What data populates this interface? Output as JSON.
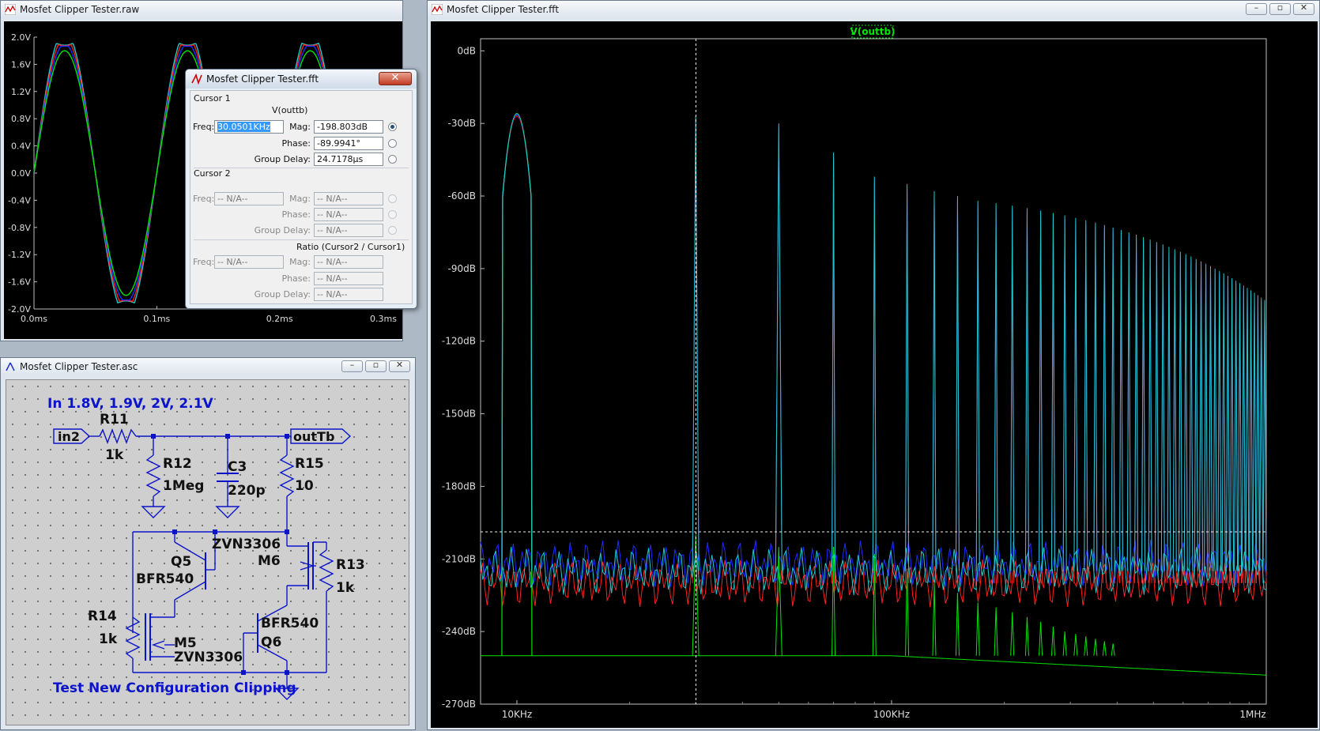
{
  "colors": {
    "green": "#00e600",
    "blue": "#1e2cff",
    "red": "#ff2020",
    "cyan": "#20c8c8",
    "schematic": "#0b14c8"
  },
  "raw_window": {
    "title": "Mosfet Clipper Tester.raw",
    "y_ticks": [
      "2.0V",
      "1.6V",
      "1.2V",
      "0.8V",
      "0.4V",
      "0.0V",
      "-0.4V",
      "-0.8V",
      "-1.2V",
      "-1.6V",
      "-2.0V"
    ],
    "x_ticks": [
      "0.0ms",
      "0.1ms",
      "0.2ms",
      "0.3ms"
    ]
  },
  "cursor_dialog": {
    "title": "Mosfet Clipper Tester.fft",
    "cursor1_label": "Cursor 1",
    "trace_label": "V(outtb)",
    "freq_label": "Freq:",
    "freq_value": "30.0501KHz",
    "mag_label": "Mag:",
    "mag_value": "-198.803dB",
    "phase_label": "Phase:",
    "phase_value": "-89.9941°",
    "group_delay_label": "Group Delay:",
    "group_delay_value": "24.7178µs",
    "cursor2_label": "Cursor 2",
    "na": "-- N/A--",
    "ratio_label": "Ratio (Cursor2 / Cursor1)"
  },
  "schematic_window": {
    "title": "Mosfet Clipper Tester.asc",
    "input_note": "In 1.8V, 1.9V, 2V, 2.1V",
    "footer_note": "Test New Configuration Clipping",
    "net_in": "in2",
    "net_out": "outTb",
    "R11": "R11",
    "R11_val": "1k",
    "R12": "R12",
    "R12_val": "1Meg",
    "C3": "C3",
    "C3_val": "220p",
    "R15": "R15",
    "R15_val": "10",
    "Q5": "Q5",
    "Q5_val": "BFR540",
    "M6": "M6",
    "M6_val": "ZVN3306",
    "R13": "R13",
    "R13_val": "1k",
    "R14": "R14",
    "R14_val": "1k",
    "M5": "M5",
    "M5_val": "ZVN3306",
    "Q6": "Q6",
    "Q6_val": "BFR540"
  },
  "fft_window": {
    "title": "Mosfet Clipper Tester.fft",
    "trace_label": "V(outtb)",
    "y_ticks": [
      "0dB",
      "-30dB",
      "-60dB",
      "-90dB",
      "-120dB",
      "-150dB",
      "-180dB",
      "-210dB",
      "-240dB",
      "-270dB"
    ],
    "x_ticks": [
      "10KHz",
      "100KHz",
      "1MHz"
    ]
  },
  "chart_data": [
    {
      "type": "line",
      "title": "",
      "xlabel": "",
      "ylabel": "",
      "x_unit": "ms",
      "y_unit": "V",
      "xlim": [
        0,
        0.3
      ],
      "ylim": [
        -2.0,
        2.0
      ],
      "grid": false,
      "series": [
        {
          "color": "#00e600",
          "frequency_khz": 10,
          "amplitude_v": 1.8,
          "clip_v": 1.8
        },
        {
          "color": "#1e2cff",
          "frequency_khz": 10,
          "amplitude_v": 1.9,
          "clip_v": 1.87
        },
        {
          "color": "#ff2020",
          "frequency_khz": 10,
          "amplitude_v": 2.0,
          "clip_v": 1.89
        },
        {
          "color": "#20c8c8",
          "frequency_khz": 10,
          "amplitude_v": 2.1,
          "clip_v": 1.91
        }
      ]
    },
    {
      "type": "line",
      "title": "",
      "xlabel": "",
      "ylabel": "",
      "x_scale": "log",
      "x_unit": "Hz",
      "y_unit": "dB",
      "xlim": [
        8000,
        1000000
      ],
      "ylim": [
        -270,
        5
      ],
      "grid": false,
      "legend": "V(outtb)",
      "cursor": {
        "freq_hz": 30050,
        "mag_db": -198.8
      },
      "harmonics": {
        "fundamental_hz": 10000,
        "orders": [
          1,
          3,
          5,
          7,
          9,
          11,
          13,
          15,
          17,
          19,
          21,
          23,
          25,
          27,
          29,
          31,
          33,
          35,
          37,
          39,
          41,
          43,
          45,
          47,
          49,
          51,
          53,
          55,
          57,
          59,
          61,
          63,
          65,
          67,
          69,
          71,
          73,
          75,
          77,
          79,
          81,
          83,
          85,
          87,
          89,
          91,
          93,
          95,
          97,
          99
        ],
        "peak_db_odd": [
          0,
          -27,
          -30,
          -42,
          -52,
          -55,
          -58,
          -60,
          -62,
          -63,
          -64,
          -65,
          -66,
          -67,
          -68,
          -69,
          -70,
          -71,
          -72,
          -73,
          -74,
          -75,
          -76,
          -77,
          -78,
          -79,
          -80,
          -81,
          -82,
          -83,
          -84,
          -85,
          -86,
          -87,
          -88,
          -89,
          -90,
          -91,
          -92,
          -93,
          -94,
          -95,
          -96,
          -97,
          -98,
          -99,
          -100,
          -101,
          -102,
          -103
        ]
      },
      "series": [
        {
          "color": "#00e600",
          "floor_db": -250,
          "harmonic_peak_db": [
            0,
            -200,
            -205,
            -205,
            -208,
            -214,
            -220,
            -224,
            -228,
            -230,
            -232,
            -234,
            -236,
            -238,
            -240,
            -241,
            -242,
            -243,
            -244,
            -245
          ]
        },
        {
          "color": "#20c8c8",
          "floor_db": -215
        },
        {
          "color": "#1e2cff",
          "floor_db": -212
        },
        {
          "color": "#ff2020",
          "floor_db": -220
        }
      ]
    }
  ]
}
